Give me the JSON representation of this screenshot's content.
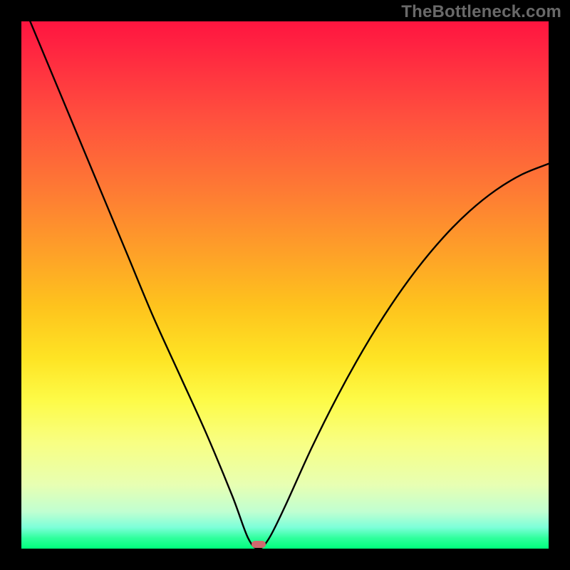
{
  "watermark": "TheBottleneck.com",
  "colors": {
    "background": "#000000",
    "curve": "#000000",
    "marker": "#cf6a6e",
    "gradient_top": "#ff153f",
    "gradient_bottom": "#00ff7c"
  },
  "chart_data": {
    "type": "line",
    "title": "",
    "xlabel": "",
    "ylabel": "",
    "xlim": [
      0,
      100
    ],
    "ylim": [
      0,
      100
    ],
    "grid": false,
    "x": [
      0,
      5,
      10,
      15,
      20,
      25,
      30,
      35,
      40,
      43,
      45,
      47,
      50,
      55,
      60,
      65,
      70,
      75,
      80,
      85,
      90,
      95,
      100
    ],
    "values": [
      104,
      92,
      80,
      68,
      56,
      44,
      33,
      22,
      10,
      2,
      0,
      2,
      8,
      19,
      29,
      38,
      46,
      53,
      59,
      64,
      68,
      71,
      73
    ],
    "optimum_x": 45,
    "marker": {
      "x": 45,
      "shape": "rounded-rect"
    }
  }
}
